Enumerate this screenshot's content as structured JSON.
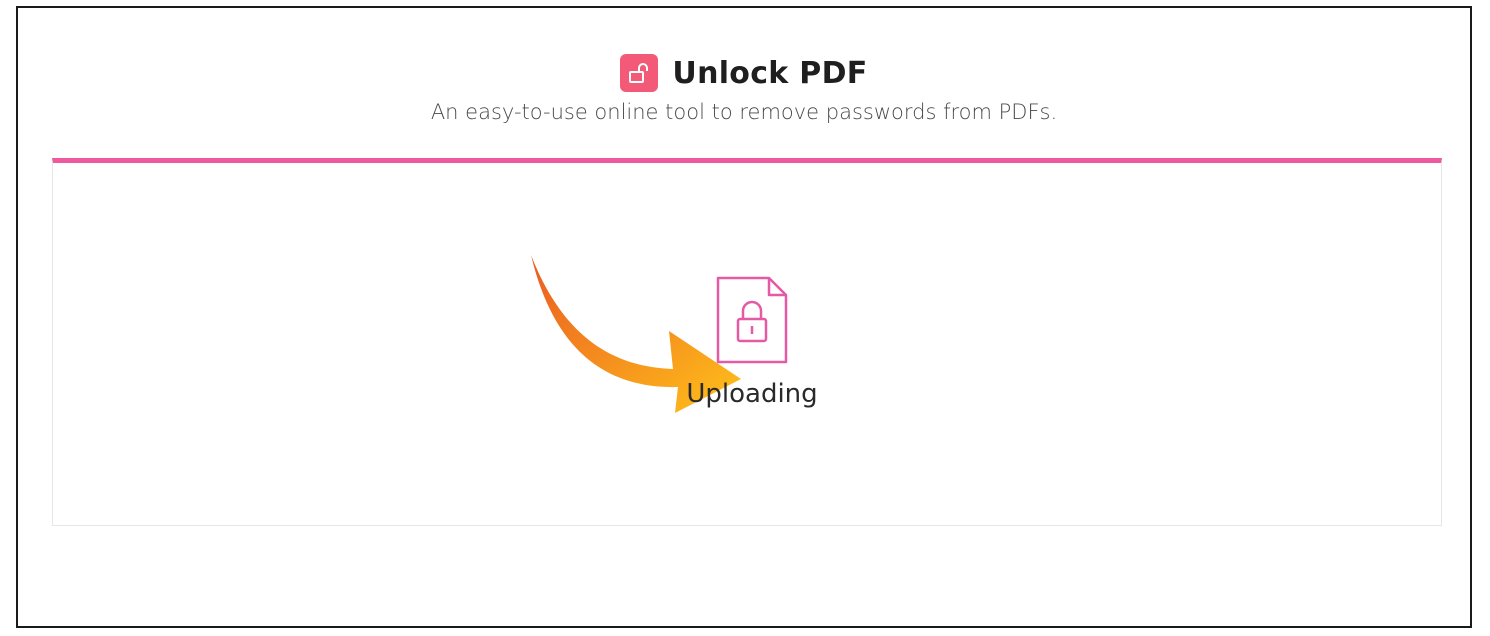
{
  "header": {
    "title": "Unlock PDF",
    "subtitle": "An easy-to-use online tool to remove passwords from PDFs.",
    "icon": "unlock-icon"
  },
  "upload": {
    "status": "Uploading",
    "file_icon": "locked-file-icon",
    "arrow_icon": "curved-arrow-icon"
  },
  "colors": {
    "accent": "#ee5a9d",
    "icon_bg": "#f25a78",
    "arrow_start": "#ea5a22",
    "arrow_end": "#ffc21a",
    "text": "#1f1f1f"
  }
}
